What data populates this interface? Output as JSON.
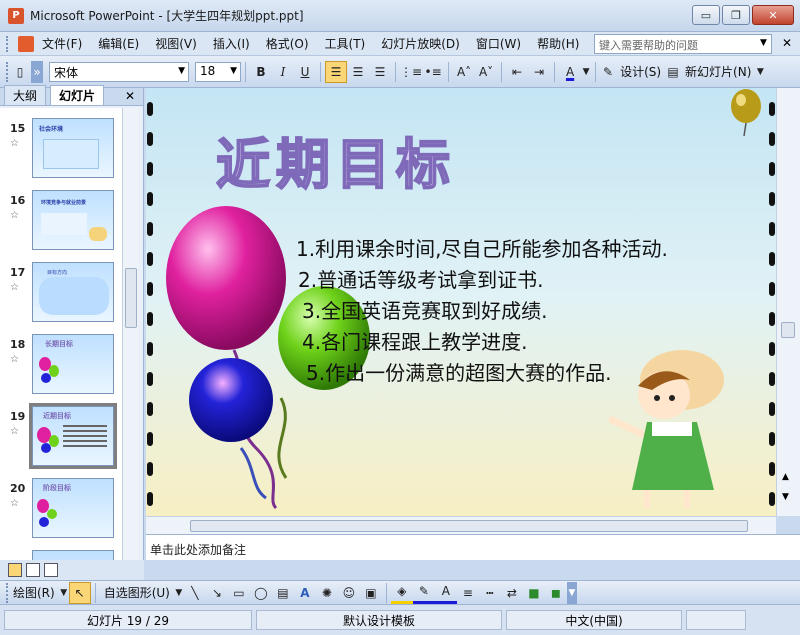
{
  "window": {
    "app_name": "Microsoft PowerPoint",
    "title": "Microsoft PowerPoint - [大学生四年规划ppt.ppt]",
    "min_glyph": "▭",
    "max_glyph": "❐",
    "close_glyph": "✕"
  },
  "menu": {
    "items": [
      "文件(F)",
      "编辑(E)",
      "视图(V)",
      "插入(I)",
      "格式(O)",
      "工具(T)",
      "幻灯片放映(D)",
      "窗口(W)",
      "帮助(H)"
    ],
    "help_placeholder": "键入需要帮助的问题",
    "close_glyph": "✕"
  },
  "toolbar": {
    "font_name": "宋体",
    "font_size": "18",
    "bold": "B",
    "italic": "I",
    "underline": "U",
    "design_label": "设计(S)",
    "new_slide_label": "新幻灯片(N)",
    "font_color_glyph": "A",
    "grow_glyph": "A˄",
    "shrink_glyph": "A˅"
  },
  "left_panel": {
    "tabs": [
      "大纲",
      "幻灯片"
    ],
    "active_tab": "幻灯片",
    "close_glyph": "✕",
    "star_glyph": "☆",
    "thumbnails": [
      {
        "number": "15",
        "title": "社会环境"
      },
      {
        "number": "16",
        "title": "环境竞争与就业前景"
      },
      {
        "number": "17",
        "title": "目标方向"
      },
      {
        "number": "18",
        "title": "长期目标"
      },
      {
        "number": "19",
        "title": "近期目标"
      },
      {
        "number": "20",
        "title": "阶段目标"
      }
    ],
    "selected_number": "19"
  },
  "slide": {
    "title": "近期目标",
    "bullets": [
      "1.利用课余时间,尽自己所能参加各种活动.",
      "2.普通话等级考试拿到证书.",
      "3.全国英语竞赛取到好成绩.",
      "4.各门课程跟上教学进度.",
      "5.作出一份满意的超图大赛的作品."
    ],
    "colors": {
      "balloon_pink": "#e0219f",
      "balloon_green": "#6fd21a",
      "balloon_blue": "#2323d8",
      "balloon_gold": "#b99b1a",
      "title_fill": "#d8c8f2",
      "title_stroke": "#7e6ab8"
    }
  },
  "notes": {
    "placeholder": "单击此处添加备注"
  },
  "drawbar": {
    "draw_label": "绘图(R)",
    "autoshape_label": "自选图形(U)"
  },
  "status": {
    "slide_info": "幻灯片 19 / 29",
    "template": "默认设计模板",
    "language": "中文(中国)"
  }
}
